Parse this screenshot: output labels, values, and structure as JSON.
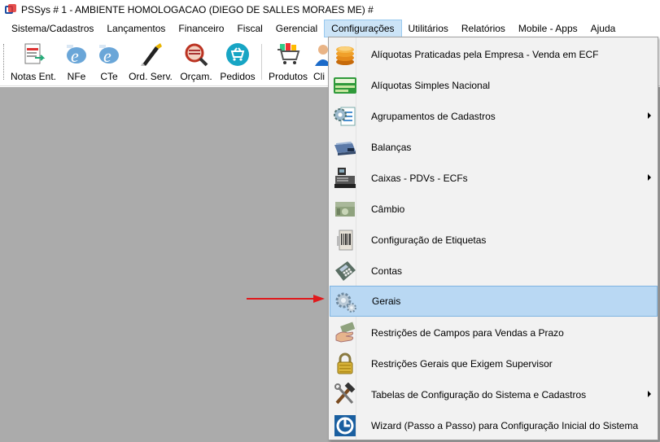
{
  "window": {
    "title": "PSSys # 1 - AMBIENTE HOMOLOGACAO (DIEGO DE SALLES MORAES ME) #"
  },
  "menubar": {
    "items": [
      {
        "label": "Sistema/Cadastros"
      },
      {
        "label": "Lançamentos"
      },
      {
        "label": "Financeiro"
      },
      {
        "label": "Fiscal"
      },
      {
        "label": "Gerencial"
      },
      {
        "label": "Configurações",
        "active": true
      },
      {
        "label": "Utilitários"
      },
      {
        "label": "Relatórios"
      },
      {
        "label": "Mobile - Apps"
      },
      {
        "label": "Ajuda"
      }
    ]
  },
  "toolbar": {
    "items": [
      {
        "label": "Notas Ent.",
        "icon": "invoice-entry-icon"
      },
      {
        "label": "NFe",
        "icon": "nfe-e-icon"
      },
      {
        "label": "CTe",
        "icon": "cte-e-icon"
      },
      {
        "label": "Ord. Serv.",
        "icon": "service-order-icon"
      },
      {
        "label": "Orçam.",
        "icon": "budget-icon"
      },
      {
        "label": "Pedidos",
        "icon": "orders-cart-icon"
      },
      {
        "label": "Produtos",
        "icon": "products-cart-icon"
      },
      {
        "label": "Cli",
        "icon": "clients-icon"
      }
    ]
  },
  "dropdown": {
    "items": [
      {
        "label": "Alíquotas Praticadas pela Empresa - Venda em ECF",
        "icon": "coins-icon",
        "submenu": false
      },
      {
        "label": "Alíquotas Simples Nacional",
        "icon": "simples-card-icon",
        "submenu": false
      },
      {
        "label": "Agrupamentos de Cadastros",
        "icon": "gear-list-icon",
        "submenu": true
      },
      {
        "label": "Balanças",
        "icon": "scale-icon",
        "submenu": false
      },
      {
        "label": "Caixas - PDVs - ECFs",
        "icon": "pos-terminal-icon",
        "submenu": true
      },
      {
        "label": "Câmbio",
        "icon": "banknotes-icon",
        "submenu": false
      },
      {
        "label": "Configuração de Etiquetas",
        "icon": "barcode-label-icon",
        "submenu": false
      },
      {
        "label": "Contas",
        "icon": "calculator-icon",
        "submenu": false
      },
      {
        "label": "Gerais",
        "icon": "gears-icon",
        "submenu": false,
        "highlighted": true
      },
      {
        "label": "Restrições de Campos para Vendas a Prazo",
        "icon": "hand-money-icon",
        "submenu": false
      },
      {
        "label": "Restrições Gerais que Exigem Supervisor",
        "icon": "padlock-icon",
        "submenu": false
      },
      {
        "label": "Tabelas de Configuração do Sistema e Cadastros",
        "icon": "hammer-wrench-icon",
        "submenu": true
      },
      {
        "label": "Wizard (Passo a Passo) para Configuração Inicial do Sistema",
        "icon": "wizard-icon",
        "submenu": false
      }
    ]
  },
  "colors": {
    "workspace": "#ababab",
    "highlight": "#b9d8f3",
    "pointer": "#e0191c"
  }
}
